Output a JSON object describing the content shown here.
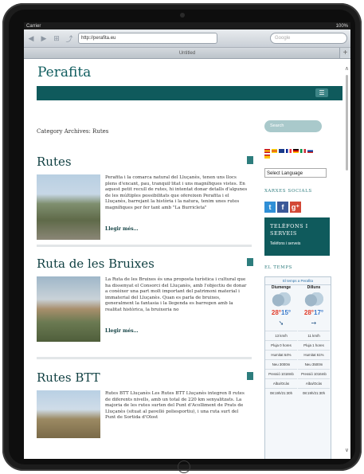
{
  "device": {
    "status_left": "Carrier",
    "status_right": "100%"
  },
  "browser": {
    "url": "http://perafita.eu",
    "search_placeholder": "Google",
    "tab_title": "Untitled",
    "new_tab": "+"
  },
  "site": {
    "title": "Perafita",
    "archive_heading": "Category Archives: Rutes"
  },
  "posts": [
    {
      "title": "Rutes",
      "excerpt": "Perafita i la comarca natural del Lluçanès, tenen uns llocs plens d'encant, pau, tranquil·litat i uns magnífiques vistes. En aquest petit recull de rutes, hi intentat donar detalls d'algunes de les múltiples possibilitats que ofereixen Perafita i el Lluçanès, barrejant la història i la natura, tenim unes rutes magnífiques per fer tant amb \"La Burricleta\"",
      "more": "Llegir més…"
    },
    {
      "title": "Ruta de les Bruixes",
      "excerpt": "La Ruta de les Bruixes és una proposta turística i cultural que ha dissenyat el Consorci del Lluçanès, amb l'objectiu de donar a conèixer una part molt important del patrimoni material i immaterial del Lluçanès. Quan es parla de bruixes, generalment la fantasia i la llegenda es barregen amb la realitat històrica, la bruixeria no",
      "more": "Llegir més…"
    },
    {
      "title": "Rutes BTT",
      "excerpt": "Rutes BTT Lluçanès Les Rutes BTT Lluçanès integren 8 rutes de diferents nivells, amb un total de 220 km senyalitzats. La majoria de les rutes surten del Punt d'Acolliment de Prats de Lluçanès (situat al pavelló poliesportiu), i una ruta surt del Punt de Sortida d'Olost",
      "more": ""
    }
  ],
  "sidebar": {
    "search_placeholder": "Search",
    "language_select": "Select Language",
    "social_heading": "XARXES SOCIALS",
    "social": [
      {
        "name": "twitter",
        "glyph": "t",
        "color": "#2f8fd6"
      },
      {
        "name": "facebook",
        "glyph": "f",
        "color": "#3b5998"
      },
      {
        "name": "google-plus",
        "glyph": "g⁺",
        "color": "#d34836"
      }
    ],
    "tel_heading": "TELÈFONS I SERVEIS",
    "tel_sub": "Telèfons i serveis",
    "weather_heading": "EL TEMPS"
  },
  "weather": {
    "top": "El temps a Perafita",
    "days": [
      {
        "day": "Diumenge",
        "hi": "28°",
        "lo": "15°",
        "wind": "13 km/h",
        "pluja": "Pluja 0 hores",
        "humitat": "Humitat 64%",
        "neu": "Neu 3000m",
        "pressio": "Pressió 1018mb",
        "alba": "Alba/Ocàs",
        "hora": "08:19h/21:30h"
      },
      {
        "day": "Dilluns",
        "hi": "28°",
        "lo": "17°",
        "wind": "11 km/h",
        "pluja": "Pluja 1 hores",
        "humitat": "Humitat 61%",
        "neu": "Neu 3500m",
        "pressio": "Pressió 1016mb",
        "alba": "Alba/Ocàs",
        "hora": "08:19h/21:30h"
      }
    ]
  }
}
